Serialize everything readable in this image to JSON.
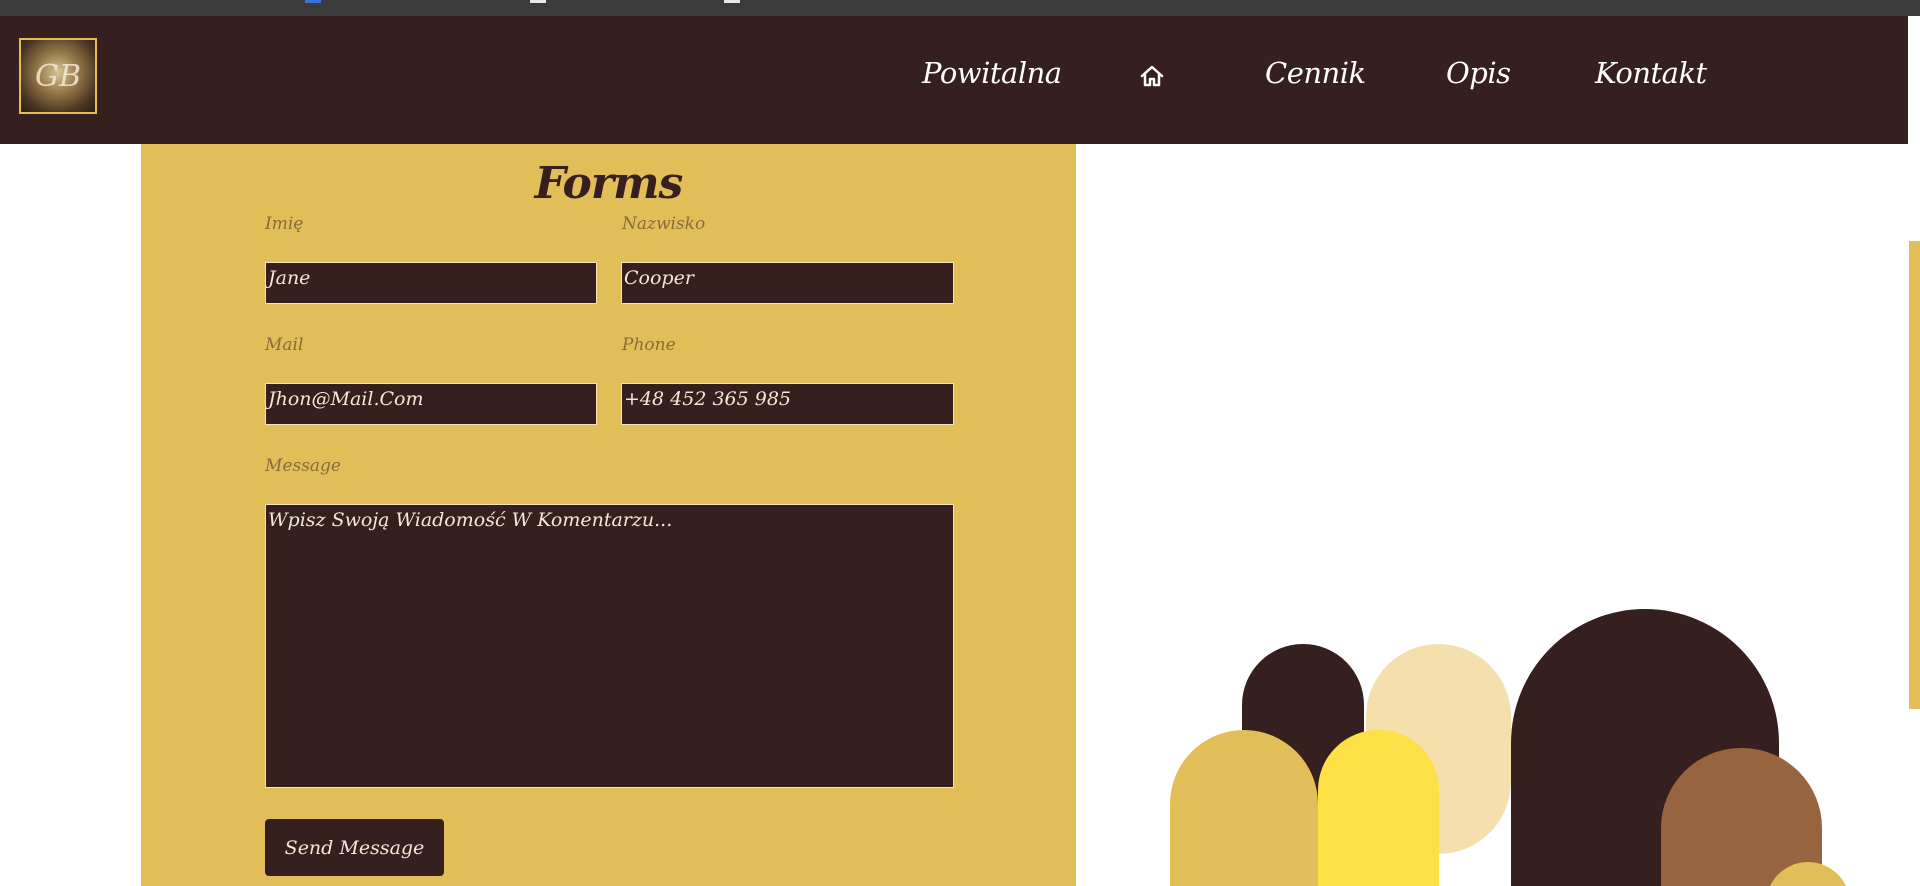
{
  "nav": {
    "items": [
      "Powitalna",
      "Cennik",
      "Opis",
      "Kontakt"
    ],
    "home_icon": "home-icon"
  },
  "logo": {
    "mark": "GB",
    "icon": "logo-emblem"
  },
  "form": {
    "title": "Forms",
    "first_name": {
      "label": "Imię",
      "value": "Jane"
    },
    "last_name": {
      "label": "Nazwisko",
      "value": "Cooper"
    },
    "mail": {
      "label": "Mail",
      "value": "Jhon@Mail.Com"
    },
    "phone": {
      "label": "Phone",
      "value": "+48 452 365 985"
    },
    "message": {
      "label": "Message",
      "value": "Wpisz Swoją Wiadomość W Komentarzu..."
    },
    "submit_label": "Send Message"
  },
  "colors": {
    "dark_brown": "#351f1f",
    "gold": "#e2be58",
    "cream": "#f5e0ad",
    "yellow": "#fde046",
    "tan": "#98633f",
    "white": "#ffffff"
  }
}
